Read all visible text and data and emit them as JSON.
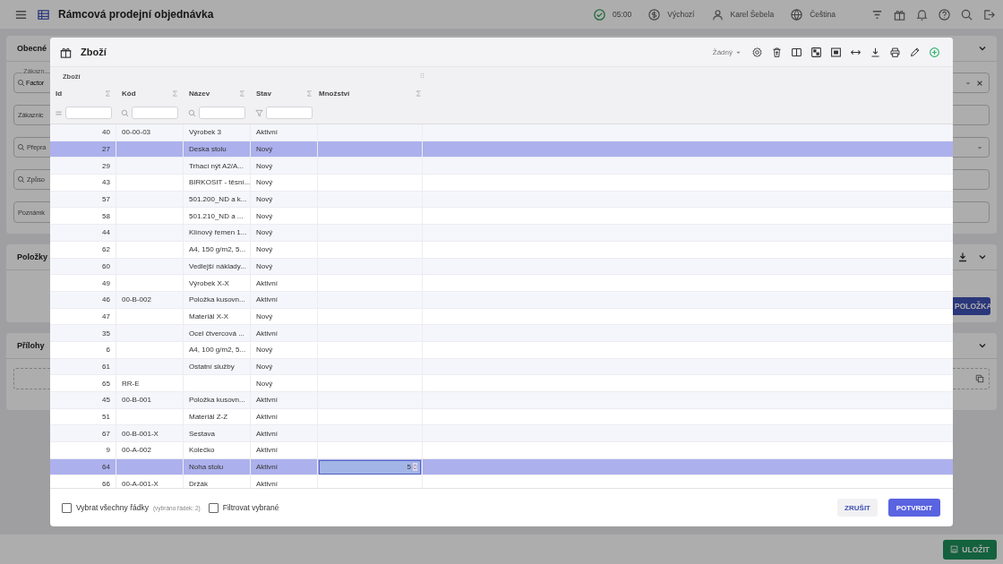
{
  "app_bar": {
    "title": "Rámcová prodejní objednávka",
    "time": "05:00",
    "currency": "Výchozí",
    "user": "Karel Šebela",
    "language": "Čeština"
  },
  "background": {
    "sections": [
      {
        "title": "Obecné",
        "fields": [
          {
            "label": "Zákazn",
            "value": "Factor",
            "kind": "select"
          },
          {
            "placeholder": "Zákaznic",
            "kind": "text"
          },
          {
            "placeholder": "Přepra",
            "kind": "search"
          },
          {
            "placeholder": "Způso",
            "kind": "search"
          },
          {
            "placeholder": "Poznámk",
            "kind": "area"
          }
        ]
      },
      {
        "title": "Položky",
        "button": "POLOŽKA"
      },
      {
        "title": "Přílohy"
      }
    ],
    "save_button": "ULOŽIT"
  },
  "dialog": {
    "title": "Zboží",
    "view_select": "Žádný",
    "group_label": "Zboží",
    "columns": [
      "Id",
      "Kód",
      "Název",
      "Stav",
      "Množství"
    ],
    "rows": [
      {
        "id": "40",
        "code": "00-00-03",
        "name": "Výrobek 3",
        "status": "Aktivní",
        "selected": false
      },
      {
        "id": "27",
        "name": "Deska stolu",
        "status": "Nový",
        "selected": true
      },
      {
        "id": "29",
        "name": "Trhací nýt A2/A...",
        "status": "Nový",
        "selected": false
      },
      {
        "id": "43",
        "name": "BIRKOSIT - těsní...",
        "status": "Nový",
        "selected": false
      },
      {
        "id": "57",
        "name": "501.200_ND a k...",
        "status": "Nový",
        "selected": false
      },
      {
        "id": "58",
        "name": "501.210_ND a ...",
        "status": "Nový",
        "selected": false
      },
      {
        "id": "44",
        "name": "Klínový řemen 1...",
        "status": "Nový",
        "selected": false
      },
      {
        "id": "62",
        "name": "A4, 150 g/m2, 5...",
        "status": "Nový",
        "selected": false
      },
      {
        "id": "60",
        "name": "Vedlejší náklady...",
        "status": "Nový",
        "selected": false
      },
      {
        "id": "49",
        "name": "Výrobek X-X",
        "status": "Aktivní",
        "selected": false
      },
      {
        "id": "46",
        "code": "00-B-002",
        "name": "Položka kusovn...",
        "status": "Aktivní",
        "selected": false
      },
      {
        "id": "47",
        "name": "Materiál X-X",
        "status": "Nový",
        "selected": false
      },
      {
        "id": "35",
        "name": "Ocel čtvercová ...",
        "status": "Aktivní",
        "selected": false
      },
      {
        "id": "6",
        "name": "A4, 100 g/m2, 5...",
        "status": "Nový",
        "selected": false
      },
      {
        "id": "61",
        "name": "Ostatní služby",
        "status": "Nový",
        "selected": false
      },
      {
        "id": "65",
        "code": "RR-E",
        "status": "Nový",
        "selected": false
      },
      {
        "id": "45",
        "code": "00-B-001",
        "name": "Položka kusovn...",
        "status": "Aktivní",
        "selected": false
      },
      {
        "id": "51",
        "name": "Materiál Z-Z",
        "status": "Aktivní",
        "selected": false
      },
      {
        "id": "67",
        "code": "00-B-001-X",
        "name": "Sestava",
        "status": "Aktivní",
        "selected": false
      },
      {
        "id": "9",
        "code": "00-A-002",
        "name": "Kolečko",
        "status": "Aktivní",
        "selected": false
      },
      {
        "id": "64",
        "name": "Noha stolu",
        "status": "Aktivní",
        "selected": true,
        "quantity": "5"
      },
      {
        "id": "66",
        "code": "00-A-001-X",
        "name": "Držák",
        "status": "Aktivní",
        "selected": false
      }
    ],
    "select_all": {
      "label": "Vybrat všechny řádky",
      "note": "(vybráno řádek: 2)",
      "checked": false
    },
    "filter_selected": {
      "label": "Filtrovat vybrané",
      "checked": false
    },
    "buttons": [
      {
        "label": "ZRUŠIT",
        "kind": "secondary"
      },
      {
        "label": "POTVRDIT",
        "kind": "primary"
      }
    ]
  }
}
